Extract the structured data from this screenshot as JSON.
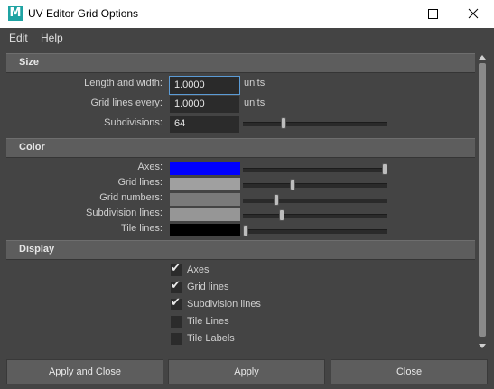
{
  "window": {
    "title": "UV Editor Grid Options",
    "app_icon_letter": "M"
  },
  "menu": [
    "Edit",
    "Help"
  ],
  "sections": {
    "size": {
      "title": "Size",
      "length_label": "Length and width:",
      "length_value": "1.0000",
      "length_unit": "units",
      "grid_every_label": "Grid lines every:",
      "grid_every_value": "1.0000",
      "grid_every_unit": "units",
      "subdivisions_label": "Subdivisions:",
      "subdivisions_value": "64",
      "subdivisions_slider": 0.27
    },
    "color": {
      "title": "Color",
      "rows": [
        {
          "label": "Axes:",
          "color": "#0000ff",
          "slider": 1.0
        },
        {
          "label": "Grid lines:",
          "color": "#a0a0a0",
          "slider": 0.34
        },
        {
          "label": "Grid numbers:",
          "color": "#7a7a7a",
          "slider": 0.22
        },
        {
          "label": "Subdivision lines:",
          "color": "#969696",
          "slider": 0.26
        },
        {
          "label": "Tile lines:",
          "color": "#000000",
          "slider": 0.0
        }
      ]
    },
    "display": {
      "title": "Display",
      "options": [
        {
          "label": "Axes",
          "checked": true
        },
        {
          "label": "Grid lines",
          "checked": true
        },
        {
          "label": "Subdivision lines",
          "checked": true
        },
        {
          "label": "Tile Lines",
          "checked": false
        },
        {
          "label": "Tile Labels",
          "checked": false
        }
      ]
    }
  },
  "buttons": {
    "apply_close": "Apply and Close",
    "apply": "Apply",
    "close": "Close"
  },
  "icons": {
    "check": "✔",
    "minimize": "minimize-icon",
    "maximize": "maximize-icon",
    "close": "close-icon"
  }
}
